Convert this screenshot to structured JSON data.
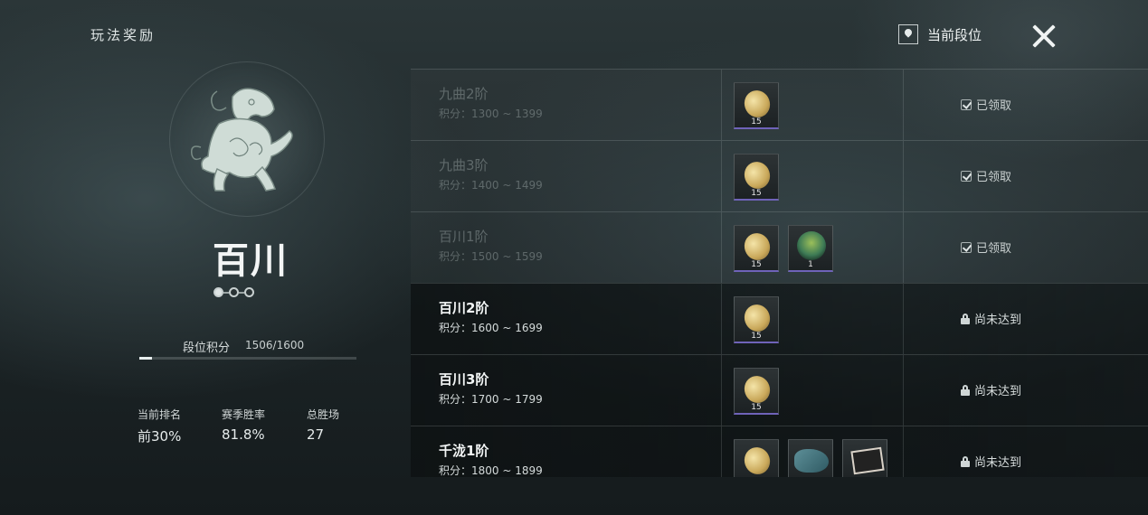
{
  "header": {
    "title": "玩法奖励",
    "current_rank_label": "当前段位"
  },
  "tier": {
    "name": "百川",
    "pips_total": 3,
    "pips_filled": 1
  },
  "score": {
    "label": "段位积分",
    "value": "1506/1600",
    "progress_fraction": 0.06
  },
  "stats": [
    {
      "label": "当前排名",
      "value": "前30%"
    },
    {
      "label": "赛季胜率",
      "value": "81.8%"
    },
    {
      "label": "总胜场",
      "value": "27"
    }
  ],
  "rewards": [
    {
      "title": "九曲2阶",
      "range": "积分：1300 ~ 1399",
      "status": "已领取",
      "claimed": true,
      "items": [
        {
          "icon": "coin-icon",
          "count": "15"
        }
      ]
    },
    {
      "title": "九曲3阶",
      "range": "积分：1400 ~ 1499",
      "status": "已领取",
      "claimed": true,
      "items": [
        {
          "icon": "coin-icon",
          "count": "15"
        }
      ]
    },
    {
      "title": "百川1阶",
      "range": "积分：1500 ~ 1599",
      "status": "已领取",
      "claimed": true,
      "items": [
        {
          "icon": "coin-icon",
          "count": "15"
        },
        {
          "icon": "tree-icon",
          "count": "1"
        }
      ]
    },
    {
      "title": "百川2阶",
      "range": "积分：1600 ~ 1699",
      "status": "尚未达到",
      "claimed": false,
      "items": [
        {
          "icon": "coin-icon",
          "count": "15"
        }
      ]
    },
    {
      "title": "百川3阶",
      "range": "积分：1700 ~ 1799",
      "status": "尚未达到",
      "claimed": false,
      "items": [
        {
          "icon": "coin-icon",
          "count": "15"
        }
      ]
    },
    {
      "title": "千泷1阶",
      "range": "积分：1800 ~ 1899",
      "status": "尚未达到",
      "claimed": false,
      "items": [
        {
          "icon": "coin-icon",
          "count": ""
        },
        {
          "icon": "fish-icon",
          "count": ""
        },
        {
          "icon": "card-icon",
          "count": ""
        }
      ]
    }
  ]
}
